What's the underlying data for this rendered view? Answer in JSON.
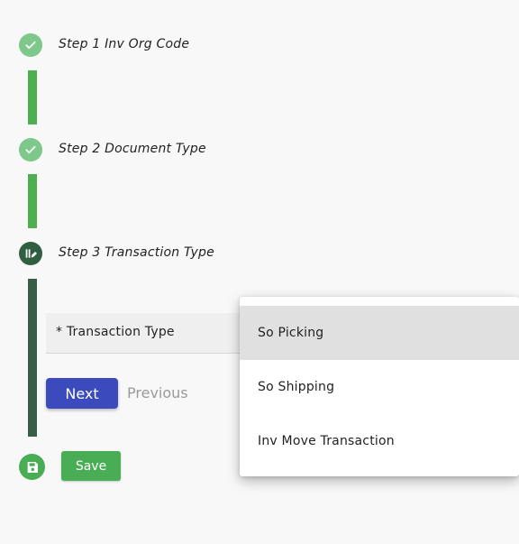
{
  "steps": [
    {
      "label": "Step 1  Inv Org Code",
      "icon": "check-icon",
      "status": "completed"
    },
    {
      "label": "Step 2 Document Type",
      "icon": "check-icon",
      "status": "completed"
    },
    {
      "label": "Step 3 Transaction Type",
      "icon": "step-active-icon",
      "status": "active"
    }
  ],
  "form": {
    "transaction_type_label": "* Transaction Type"
  },
  "buttons": {
    "next": "Next",
    "previous": "Previous",
    "save": "Save"
  },
  "dropdown": {
    "options": [
      "So Picking",
      "So Shipping",
      "Inv Move Transaction"
    ],
    "highlighted": "So Picking"
  },
  "colors": {
    "completed": "#7dc88a",
    "connector_completed": "#4caf50",
    "active": "#2f5e40",
    "connector_active": "#375f45",
    "primary_button": "#3b4bbd",
    "save_button": "#49ad55"
  }
}
